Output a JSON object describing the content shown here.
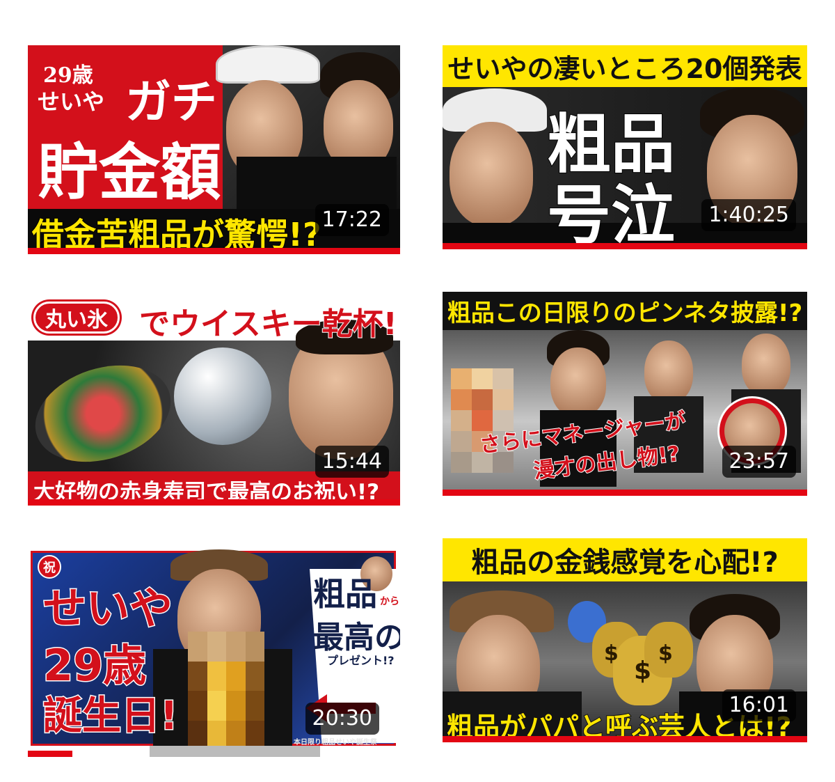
{
  "thumbnails": [
    {
      "id": "t1",
      "duration": "17:22",
      "texts": {
        "age": "29歳",
        "name": "せいや",
        "gachi": "ガチ",
        "main": "貯金額",
        "bottom": "借金苦粗品が驚愕!?"
      }
    },
    {
      "id": "t2",
      "duration": "1:40:25",
      "texts": {
        "top": "せいやの凄いところ20個発表",
        "main1": "粗品",
        "main2": "号泣"
      }
    },
    {
      "id": "t3",
      "duration": "15:44",
      "texts": {
        "pill": "丸い氷",
        "top": "でウイスキー乾杯!",
        "bottom": "大好物の赤身寿司で最高のお祝い!?"
      }
    },
    {
      "id": "t4",
      "duration": "23:57",
      "texts": {
        "top": "粗品この日限りのピンネタ披露!?",
        "mid1": "さらにマネージャーが",
        "mid2": "漫才の出し物!?"
      }
    },
    {
      "id": "t5",
      "duration": "20:30",
      "texts": {
        "badge": "祝",
        "name": "せいや",
        "age": "29歳",
        "bday": "誕生日!",
        "from1": "粗品",
        "kara": "から",
        "from2": "最高の",
        "present": "プレゼント!?",
        "small": "本日限り粗品せいや誕生祭"
      }
    },
    {
      "id": "t6",
      "duration": "16:01",
      "texts": {
        "top": "粗品の金銭感覚を心配!?",
        "bottom": "粗品がパパと呼ぶ芸人とは!?"
      }
    }
  ],
  "colors": {
    "red": "#e30613",
    "yellow": "#ffe600",
    "navy": "#13204a",
    "blue": "#1b3fa0"
  },
  "progress": {
    "t1": 1.0,
    "t2": 1.0,
    "t3": 1.0,
    "t4": 1.0,
    "t5": 0.12,
    "t6": 1.0
  }
}
